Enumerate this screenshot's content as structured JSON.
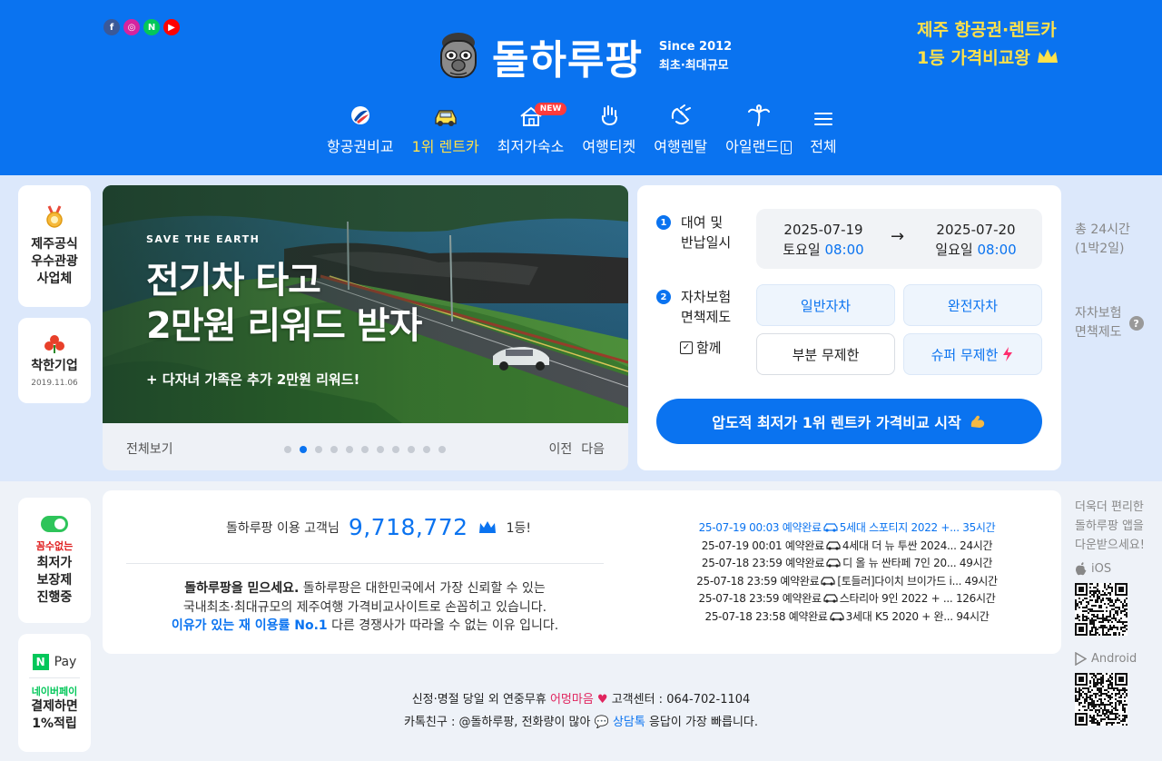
{
  "header": {
    "socials": [
      "f",
      "◎",
      "N",
      "▶"
    ],
    "brand": "돌하루팡",
    "since": "Since 2012",
    "tagline": "최초·최대규모",
    "promo_line1": "제주 항공권·렌트카",
    "promo_line2": "1등 가격비교왕",
    "colors": {
      "primary": "#0a73f0",
      "accent": "#ffe14a"
    }
  },
  "nav": {
    "items": [
      {
        "label": "항공권비교",
        "icon": "airline-icon"
      },
      {
        "label": "1위 렌트카",
        "icon": "car-icon"
      },
      {
        "label": "최저가숙소",
        "icon": "house-icon",
        "badge": "NEW"
      },
      {
        "label": "여행티켓",
        "icon": "hand-icon"
      },
      {
        "label": "여행렌탈",
        "icon": "clap-icon"
      },
      {
        "label": "아일랜드",
        "icon": "palm-icon",
        "suffix": "L"
      },
      {
        "label": "전체",
        "icon": "menu-icon"
      }
    ]
  },
  "side": {
    "card1": "제주공식\n우수관광\n사업체",
    "card2_title": "착한기업",
    "card2_date": "2019.11.06",
    "card3_red": "꼼수없는",
    "card3_title": "최저가\n보장제\n진행중",
    "card4_pay": "Pay",
    "card4_green": "네이버페이",
    "card4_title": "결제하면\n1%적립"
  },
  "banner": {
    "kicker": "SAVE THE EARTH",
    "headline": "전기차 타고\n2만원 리워드 받자",
    "sub": "+ 다자녀 가족은 추가 2만원 리워드!",
    "view_all": "전체보기",
    "prev": "이전",
    "next": "다음",
    "slide_count": 11,
    "active_slide": 1
  },
  "booking": {
    "step1_label": "대여 및\n반납일시",
    "pickup_date": "2025-07-19",
    "pickup_day": "토요일",
    "pickup_time": "08:00",
    "return_date": "2025-07-20",
    "return_day": "일요일",
    "return_time": "08:00",
    "step2_label": "자차보험\n면책제도",
    "with_label": "함께",
    "opt_general": "일반자차",
    "opt_full": "완전자차",
    "opt_partial": "부분 무제한",
    "opt_super": "슈퍼 무제한",
    "cta": "압도적 최저가 1위 렌트카 가격비교 시작"
  },
  "right": {
    "duration": "총 24시간",
    "duration_sub": "(1박2일)",
    "insurance": "자차보험\n면책제도"
  },
  "stats": {
    "label": "돌하루팡 이용 고객님",
    "count": "9,718,772",
    "rank": "1등!",
    "para_bold": "돌하루팡을 믿으세요.",
    "para_1": " 돌하루팡은 대한민국에서 가장 신뢰할 수 있는",
    "para_2": "국내최초·최대규모의 제주여행 가격비교사이트로 손꼽히고 있습니다.",
    "para_hl": "이유가 있는 재 이용률 No.1",
    "para_3": " 다른 경쟁사가 따라올 수 없는 이유 입니다.",
    "feed": [
      {
        "time": "25-07-19 00:03",
        "status": "예약완료",
        "car": "5세대 스포티지 2022 +...",
        "dur": "35시간"
      },
      {
        "time": "25-07-19 00:01",
        "status": "예약완료",
        "car": "4세대 더 뉴 투싼 2024...",
        "dur": "24시간"
      },
      {
        "time": "25-07-18 23:59",
        "status": "예약완료",
        "car": "디 올 뉴 싼타페 7인 20...",
        "dur": "49시간"
      },
      {
        "time": "25-07-18 23:59",
        "status": "예약완료",
        "car": "[토들러]다이치 브이가드 i...",
        "dur": "49시간"
      },
      {
        "time": "25-07-18 23:59",
        "status": "예약완료",
        "car": "스타리아 9인 2022 + ...",
        "dur": "126시간"
      },
      {
        "time": "25-07-18 23:58",
        "status": "예약완료",
        "car": "3세대 K5 2020 + 완...",
        "dur": "94시간"
      }
    ]
  },
  "app": {
    "text": "더욱더 편리한\n돌하루팡 앱을\n다운받으세요!",
    "ios": "iOS",
    "android": "Android"
  },
  "footer": {
    "line1_a": "신정·명절 당일 외 연중무휴 ",
    "line1_red": "어멍마음",
    "line1_b": " 고객센터 : 064-702-1104",
    "line2_a": "카톡친구 : @돌하루팡, 전화량이 많아 ",
    "line2_blue": "상담톡",
    "line2_b": " 응답이 가장 빠릅니다."
  }
}
